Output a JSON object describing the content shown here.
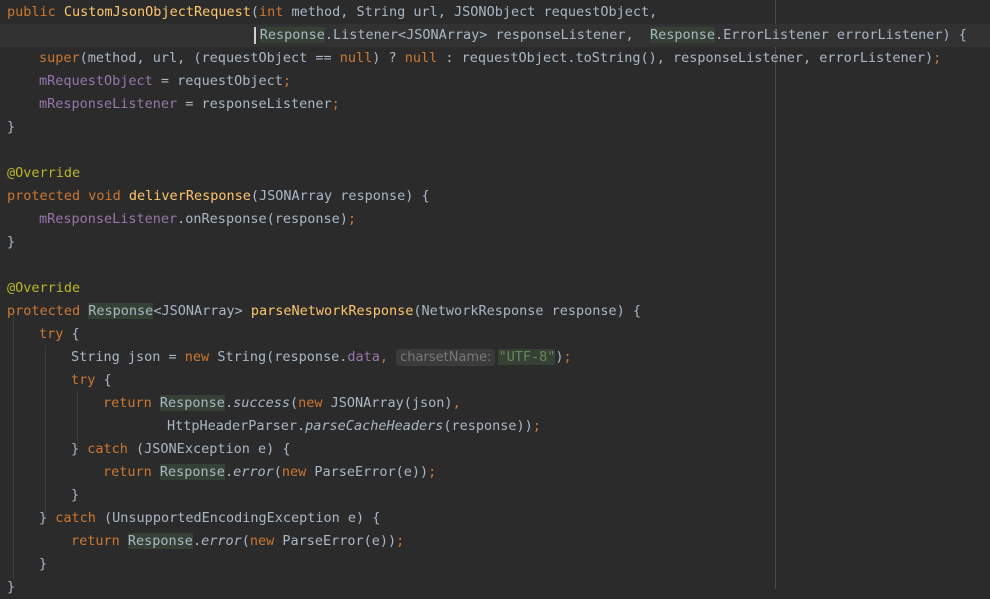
{
  "editor": {
    "theme_colors": {
      "background": "#2b2b2b",
      "keyword": "#cc7832",
      "method": "#ffc66d",
      "field": "#9876aa",
      "string": "#6a8759",
      "annotation": "#bbb529",
      "text": "#a9b7c6"
    },
    "lines": [
      {
        "indent": 0,
        "tokens": [
          {
            "t": "public ",
            "c": "kw"
          },
          {
            "t": "CustomJsonObjectRequest",
            "c": "fn"
          },
          {
            "t": "("
          },
          {
            "t": "int ",
            "c": "kw"
          },
          {
            "t": "method, String url, JSONObject requestObject,"
          }
        ]
      },
      {
        "indent": 31.6,
        "current": true,
        "tokens": [
          {
            "t": "Response",
            "c": "hl"
          },
          {
            "t": ".Listener<JSONArray> responseListener,  "
          },
          {
            "t": "Response",
            "c": "hl"
          },
          {
            "t": ".ErrorListener errorListener) {"
          }
        ]
      },
      {
        "indent": 4,
        "tokens": [
          {
            "t": "super",
            "c": "kw"
          },
          {
            "t": "(method, url, (requestObject == "
          },
          {
            "t": "null",
            "c": "kw"
          },
          {
            "t": ") ? "
          },
          {
            "t": "null",
            "c": "kw"
          },
          {
            "t": " : requestObject.toString(), responseListener, errorListener)"
          },
          {
            "t": ";",
            "c": "kw"
          }
        ]
      },
      {
        "indent": 4,
        "tokens": [
          {
            "t": "mRequestObject",
            "c": "field"
          },
          {
            "t": " = requestObject"
          },
          {
            "t": ";",
            "c": "kw"
          }
        ]
      },
      {
        "indent": 4,
        "tokens": [
          {
            "t": "mResponseListener",
            "c": "field"
          },
          {
            "t": " = responseListener"
          },
          {
            "t": ";",
            "c": "kw"
          }
        ]
      },
      {
        "indent": 0,
        "tokens": [
          {
            "t": "}"
          }
        ]
      },
      {
        "indent": 0,
        "tokens": []
      },
      {
        "indent": 0,
        "tokens": [
          {
            "t": "@Override",
            "c": "ann"
          }
        ]
      },
      {
        "indent": 0,
        "tokens": [
          {
            "t": "protected void ",
            "c": "kw"
          },
          {
            "t": "deliverResponse",
            "c": "fn"
          },
          {
            "t": "(JSONArray response) {"
          }
        ]
      },
      {
        "indent": 4,
        "tokens": [
          {
            "t": "mResponseListener",
            "c": "field"
          },
          {
            "t": ".onResponse(response)"
          },
          {
            "t": ";",
            "c": "kw"
          }
        ]
      },
      {
        "indent": 0,
        "tokens": [
          {
            "t": "}"
          }
        ]
      },
      {
        "indent": 0,
        "tokens": []
      },
      {
        "indent": 0,
        "tokens": [
          {
            "t": "@Override",
            "c": "ann"
          }
        ]
      },
      {
        "indent": 0,
        "tokens": [
          {
            "t": "protected ",
            "c": "kw"
          },
          {
            "t": "Response",
            "c": "hl"
          },
          {
            "t": "<JSONArray> "
          },
          {
            "t": "parseNetworkResponse",
            "c": "fn"
          },
          {
            "t": "(NetworkResponse response) {"
          }
        ]
      },
      {
        "indent": 4,
        "tokens": [
          {
            "t": "try ",
            "c": "kw"
          },
          {
            "t": "{"
          }
        ]
      },
      {
        "indent": 8,
        "tokens": [
          {
            "t": "String json = "
          },
          {
            "t": "new ",
            "c": "kw"
          },
          {
            "t": "String(response."
          },
          {
            "t": "data",
            "c": "field"
          },
          {
            "t": ", ",
            "c": "kw"
          },
          {
            "t": "charsetName:",
            "c": "hint"
          },
          {
            "t": "\"UTF-8\"",
            "c": "str hl"
          },
          {
            "t": ")"
          },
          {
            "t": ";",
            "c": "kw"
          }
        ]
      },
      {
        "indent": 8,
        "tokens": [
          {
            "t": "try ",
            "c": "kw"
          },
          {
            "t": "{"
          }
        ]
      },
      {
        "indent": 12,
        "tokens": [
          {
            "t": "return ",
            "c": "kw"
          },
          {
            "t": "Response",
            "c": "hl"
          },
          {
            "t": "."
          },
          {
            "t": "success",
            "c": "smeth"
          },
          {
            "t": "("
          },
          {
            "t": "new ",
            "c": "kw"
          },
          {
            "t": "JSONArray(json)"
          },
          {
            "t": ",",
            "c": "kw"
          }
        ]
      },
      {
        "indent": 20,
        "tokens": [
          {
            "t": "HttpHeaderParser."
          },
          {
            "t": "parseCacheHeaders",
            "c": "smeth"
          },
          {
            "t": "(response))"
          },
          {
            "t": ";",
            "c": "kw"
          }
        ]
      },
      {
        "indent": 8,
        "tokens": [
          {
            "t": "} "
          },
          {
            "t": "catch ",
            "c": "kw"
          },
          {
            "t": "(JSONException e) {"
          }
        ]
      },
      {
        "indent": 12,
        "tokens": [
          {
            "t": "return ",
            "c": "kw"
          },
          {
            "t": "Response",
            "c": "hl"
          },
          {
            "t": "."
          },
          {
            "t": "error",
            "c": "smeth"
          },
          {
            "t": "("
          },
          {
            "t": "new ",
            "c": "kw"
          },
          {
            "t": "ParseError(e))"
          },
          {
            "t": ";",
            "c": "kw"
          }
        ]
      },
      {
        "indent": 8,
        "tokens": [
          {
            "t": "}"
          }
        ]
      },
      {
        "indent": 4,
        "tokens": [
          {
            "t": "} "
          },
          {
            "t": "catch ",
            "c": "kw"
          },
          {
            "t": "(UnsupportedEncodingException e) {"
          }
        ]
      },
      {
        "indent": 8,
        "tokens": [
          {
            "t": "return ",
            "c": "kw"
          },
          {
            "t": "Response",
            "c": "hl"
          },
          {
            "t": "."
          },
          {
            "t": "error",
            "c": "smeth"
          },
          {
            "t": "("
          },
          {
            "t": "new ",
            "c": "kw"
          },
          {
            "t": "ParseError(e))"
          },
          {
            "t": ";",
            "c": "kw"
          }
        ]
      },
      {
        "indent": 4,
        "tokens": [
          {
            "t": "}"
          }
        ]
      },
      {
        "indent": 0,
        "tokens": [
          {
            "t": "}"
          }
        ]
      }
    ]
  }
}
